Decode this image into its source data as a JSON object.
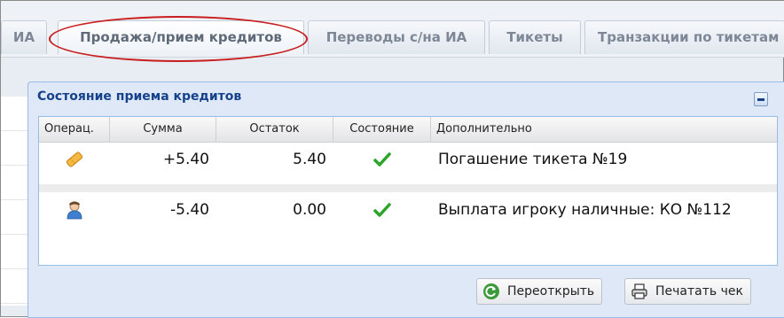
{
  "tabs": [
    {
      "label": "ИА"
    },
    {
      "label": "Продажа/прием кредитов",
      "active": true
    },
    {
      "label": "Переводы с/на ИА"
    },
    {
      "label": "Тикеты"
    },
    {
      "label": "Транзакции по тикетам"
    }
  ],
  "panel": {
    "title": "Состояние приема кредитов",
    "columns": [
      "Операц.",
      "Сумма",
      "Остаток",
      "Состояние",
      "Дополнительно"
    ],
    "rows": [
      {
        "op_icon": "ticket-icon",
        "amount": "+5.40",
        "balance": "5.40",
        "status_icon": "checkmark-icon",
        "details": "Погашение тикета №19"
      },
      {
        "op_icon": "user-icon",
        "amount": "-5.40",
        "balance": "0.00",
        "status_icon": "checkmark-icon",
        "details": "Выплата игроку наличные: КО №112"
      }
    ]
  },
  "buttons": {
    "reopen": "Переоткрыть",
    "print": "Печатать чек"
  },
  "colors": {
    "accent": "#15428b",
    "highlight": "#c81e1e",
    "check": "#2aa52a"
  }
}
